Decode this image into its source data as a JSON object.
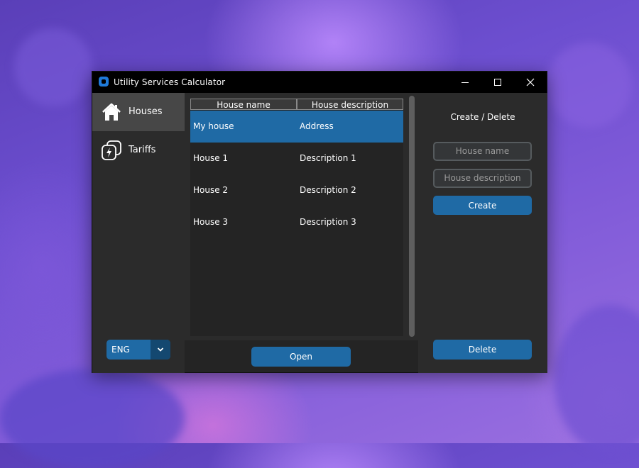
{
  "window": {
    "title": "Utility Services Calculator"
  },
  "sidebar": {
    "items": [
      {
        "label": "Houses",
        "icon": "house-icon",
        "active": true
      },
      {
        "label": "Tariffs",
        "icon": "lightning-icon",
        "active": false
      }
    ],
    "language": "ENG"
  },
  "table": {
    "columns": [
      "House name",
      "House description"
    ],
    "rows": [
      {
        "name": "My house",
        "description": "Address",
        "selected": true
      },
      {
        "name": "House 1",
        "description": "Description 1",
        "selected": false
      },
      {
        "name": "House 2",
        "description": "Description 2",
        "selected": false
      },
      {
        "name": "House 3",
        "description": "Description 3",
        "selected": false
      }
    ]
  },
  "open_label": "Open",
  "panel": {
    "title": "Create / Delete",
    "name_placeholder": "House name",
    "description_placeholder": "House description",
    "create_label": "Create",
    "delete_label": "Delete"
  },
  "colors": {
    "accent": "#1f6aa5",
    "selected_row": "#1f6aa5",
    "window_bg": "#242424"
  }
}
